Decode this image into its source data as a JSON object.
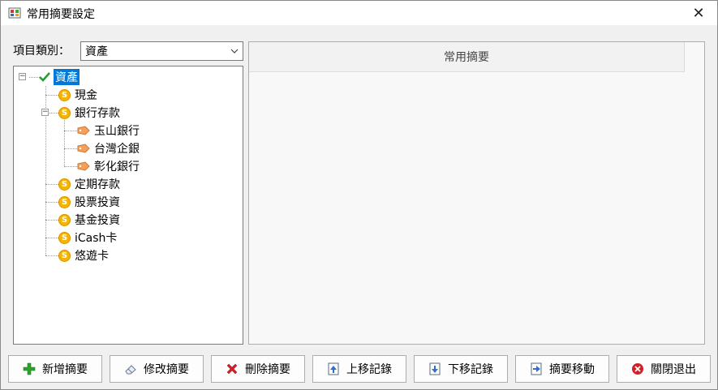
{
  "window": {
    "title": "常用摘要設定",
    "close_glyph": "✕"
  },
  "category": {
    "label": "項目類別：",
    "selected": "資產"
  },
  "tree": {
    "root": "資產",
    "nodes": [
      {
        "label": "現金"
      },
      {
        "label": "銀行存款",
        "children": [
          "玉山銀行",
          "台灣企銀",
          "彰化銀行"
        ]
      },
      {
        "label": "定期存款"
      },
      {
        "label": "股票投資"
      },
      {
        "label": "基金投資"
      },
      {
        "label": "iCash卡"
      },
      {
        "label": "悠遊卡"
      }
    ],
    "coin_glyph": "S"
  },
  "list": {
    "column_header": "常用摘要"
  },
  "buttons": {
    "add": "新增摘要",
    "edit": "修改摘要",
    "delete": "刪除摘要",
    "move_up": "上移記錄",
    "move_down": "下移記錄",
    "move_summary": "摘要移動",
    "close": "關閉退出"
  },
  "colors": {
    "accent": "#0078d7",
    "coin": "#f5b400",
    "add_icon": "#2ea02e",
    "delete_icon": "#d0202a"
  }
}
